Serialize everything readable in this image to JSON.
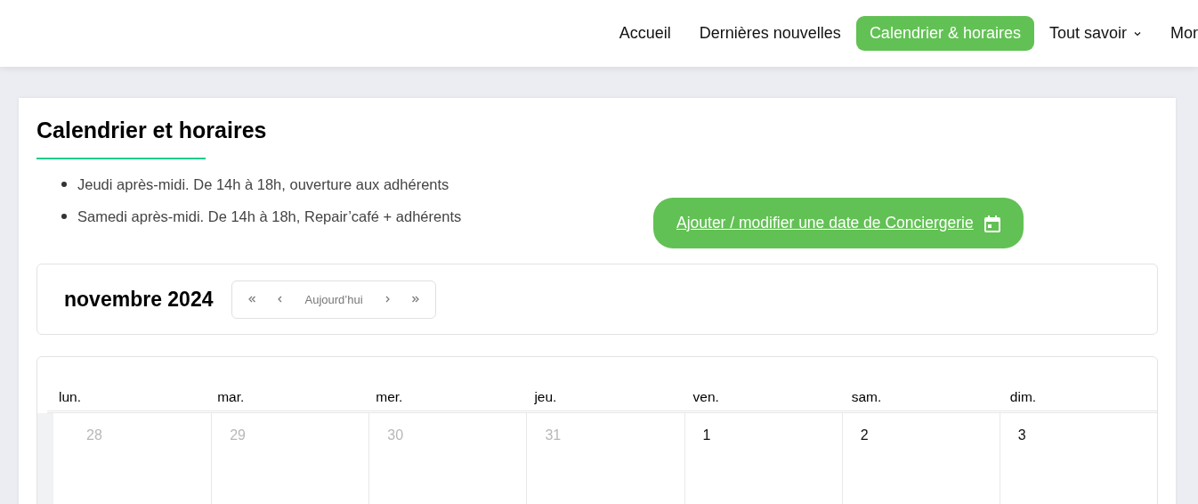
{
  "nav": {
    "items": [
      {
        "label": "Accueil",
        "selected": false,
        "dropdown": false
      },
      {
        "label": "Dernières nouvelles",
        "selected": false,
        "dropdown": false
      },
      {
        "label": "Calendrier & horaires",
        "selected": true,
        "dropdown": false
      },
      {
        "label": "Tout savoir",
        "selected": false,
        "dropdown": true
      },
      {
        "label": "Mor",
        "selected": false,
        "dropdown": false
      }
    ]
  },
  "page": {
    "title": "Calendrier et horaires",
    "schedule": [
      "Jeudi après-midi. De 14h à 18h, ouverture aux adhérents",
      "Samedi après-midi. De 14h à 18h, Repair’café + adhérents"
    ],
    "add_button": "Ajouter / modifier une date de Conciergerie"
  },
  "calendar": {
    "month": "novembre 2024",
    "today_button": "Aujourd’hui",
    "weekdays": [
      "lun.",
      "mar.",
      "mer.",
      "jeu.",
      "ven.",
      "sam.",
      "dim."
    ],
    "days": [
      {
        "label": "28",
        "other_month": true
      },
      {
        "label": "29",
        "other_month": true
      },
      {
        "label": "30",
        "other_month": true
      },
      {
        "label": "31",
        "other_month": true
      },
      {
        "label": "1",
        "other_month": false
      },
      {
        "label": "2",
        "other_month": false
      },
      {
        "label": "3",
        "other_month": false
      }
    ]
  }
}
